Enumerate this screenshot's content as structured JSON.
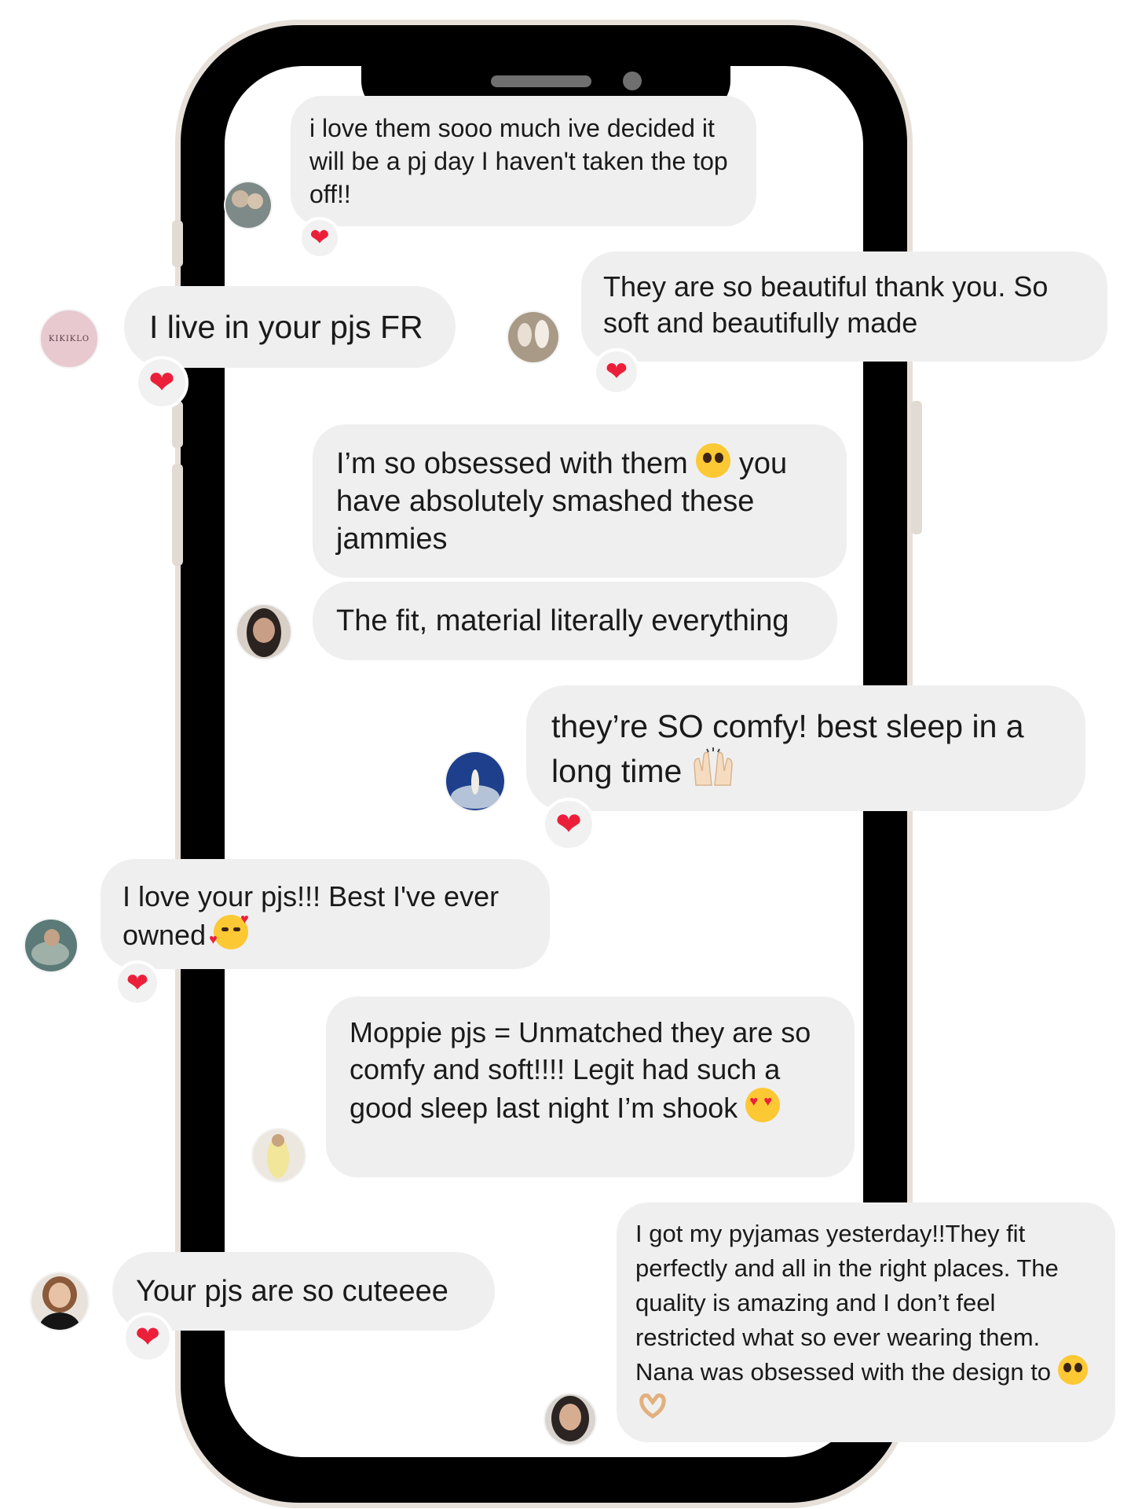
{
  "colors": {
    "phone_frame": "#000000",
    "phone_trim": "#e7e0d9",
    "bubble": "#efefef",
    "heart": "#ec1f3a",
    "emoji_yellow": "#fcc834"
  },
  "messages": [
    {
      "text": "i love them sooo much ive decided it will be a pj day I haven't taken the top off!!",
      "reaction": "❤",
      "avatar": "avatar-photo"
    },
    {
      "text": "I live in your pjs FR",
      "reaction": "❤",
      "avatar": "kikiklo-logo-avatar",
      "avatar_text": "KIKIKLO"
    },
    {
      "text": "They are so beautiful thank you.  So soft and beautifully made",
      "reaction": "❤",
      "avatar": "avatar-photo"
    },
    {
      "text_a": "I’m so obsessed with them",
      "text_b": "you have absolutely smashed these jammies",
      "emoji": "pleading-face-emoji",
      "avatar": "avatar-photo"
    },
    {
      "text": "The fit, material literally everything"
    },
    {
      "text": "they’re SO comfy! best sleep in a long time",
      "emoji": "raising-hands-emoji",
      "reaction": "❤",
      "avatar": "avatar-photo"
    },
    {
      "text": "I love your pjs!!! Best I've ever owned",
      "emoji": "smiling-face-with-hearts-emoji",
      "reaction": "❤",
      "avatar": "avatar-photo"
    },
    {
      "text": "Moppie pjs = Unmatched they are so comfy and soft!!!! Legit had such a good sleep last night I’m shook",
      "emoji": "heart-eyes-emoji",
      "avatar": "avatar-photo"
    },
    {
      "text": "Your pjs are so cuteeee",
      "reaction": "❤",
      "avatar": "avatar-photo"
    },
    {
      "text": "I got my pyjamas yesterday!!They fit perfectly and all in the right places. The quality is amazing and I don’t feel restricted what so ever wearing them. Nana was obsessed with the design to",
      "emoji": "pleading-face-emoji",
      "avatar": "avatar-photo"
    }
  ]
}
